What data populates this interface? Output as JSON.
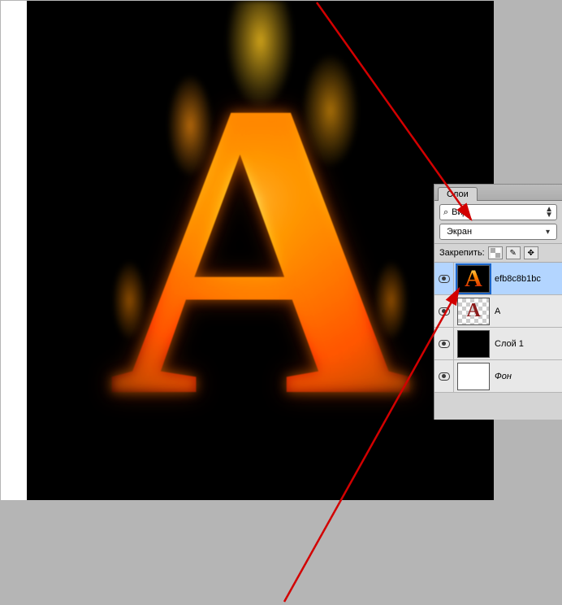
{
  "canvas": {
    "letter": "A"
  },
  "panel": {
    "tab_label": "Слои",
    "filter_label": "Вид",
    "blend_mode": "Экран",
    "lock_label": "Закрепить:"
  },
  "layers": [
    {
      "name": "efb8c8b1bc",
      "thumb": "fire",
      "selected": true,
      "visible": true,
      "italic": false
    },
    {
      "name": "A",
      "thumb": "checker-A",
      "selected": false,
      "visible": true,
      "italic": false
    },
    {
      "name": "Слой 1",
      "thumb": "black",
      "selected": false,
      "visible": true,
      "italic": false
    },
    {
      "name": "Фон",
      "thumb": "white",
      "selected": false,
      "visible": true,
      "italic": true
    }
  ]
}
